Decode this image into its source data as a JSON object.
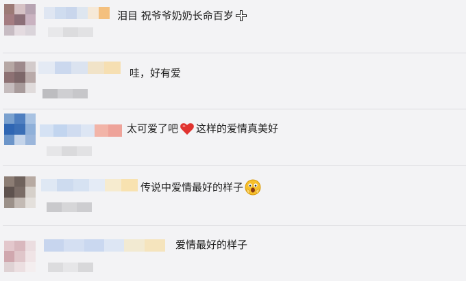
{
  "comments": [
    {
      "text": "泪目 祝爷爷奶奶长命百岁",
      "emoji": "cross-icon",
      "avatar_colors": [
        "#9c7a76",
        "#d6c2c5",
        "#b7a4b2",
        "#a47c81",
        "#8c6f78",
        "#c9b2c0",
        "#c7bcc3",
        "#e4dbe0",
        "#dad4da"
      ],
      "name_pixel_colors": [
        "#dfe6f2",
        "#cfdcef",
        "#c9d6ec",
        "#dee6f0",
        "#f6e9d8",
        "#f4c07e"
      ],
      "meta_pixel_colors": [
        "#e8e8ea",
        "#dcdcde",
        "#e2e2e4"
      ]
    },
    {
      "text": "哇，好有爱",
      "emoji": "",
      "avatar_colors": [
        "#b6a7a4",
        "#9e8a8c",
        "#d3cbcb",
        "#8d7173",
        "#7d6769",
        "#b9aaa9",
        "#c5bcbd",
        "#a89b9b",
        "#e0dbdb"
      ],
      "name_pixel_colors": [
        "#e4eaf4",
        "#cbd8ee",
        "#dbe3f0",
        "#f1e3c8",
        "#f6dfb2"
      ],
      "meta_pixel_colors": [
        "#bdbdc0",
        "#cfcfd2",
        "#c7c7ca"
      ]
    },
    {
      "text": "太可爱了吧",
      "text2": "这样的爱情真美好",
      "emoji": "heart-icon",
      "avatar_colors": [
        "#7aa1cf",
        "#4f7fc0",
        "#a8c2e2",
        "#2f66b3",
        "#3b6fb6",
        "#8fb0d9",
        "#6c95c9",
        "#c4d4ea",
        "#9bb6db"
      ],
      "name_pixel_colors": [
        "#d5e2f4",
        "#c2d5ef",
        "#d0dcf0",
        "#dde6f4",
        "#f2b4a8",
        "#eea39a"
      ],
      "meta_pixel_colors": [
        "#e6e6e8",
        "#dadadc",
        "#e2e2e4"
      ]
    },
    {
      "text": "传说中爱情最好的样子",
      "emoji": "face-icon",
      "avatar_colors": [
        "#8c7d74",
        "#6f625c",
        "#b7aaa2",
        "#5e524e",
        "#7a6c66",
        "#d6d0ca",
        "#9b9089",
        "#c3bab4",
        "#e4e0dc"
      ],
      "name_pixel_colors": [
        "#dfe8f4",
        "#cddbef",
        "#d6e2f2",
        "#e4ebf6",
        "#f6ebcf",
        "#f8e2b0"
      ],
      "meta_pixel_colors": [
        "#c9c9cc",
        "#d6d6d8",
        "#cdcdd0"
      ]
    },
    {
      "text": "爱情最好的样子",
      "emoji": "",
      "avatar_colors": [
        "#e3c7cc",
        "#d9b8be",
        "#ebdde0",
        "#d0a7ae",
        "#e0c6ca",
        "#f0e4e6",
        "#dfd2d4",
        "#ecdfe1",
        "#f4eeef"
      ],
      "name_pixel_colors": [
        "#c7d5ee",
        "#d4dff2",
        "#cad8f0",
        "#dde6f4",
        "#f2ead2",
        "#f5e4bd"
      ],
      "meta_pixel_colors": [
        "#dcdcde",
        "#e6e6e8",
        "#d8d8da"
      ]
    }
  ]
}
